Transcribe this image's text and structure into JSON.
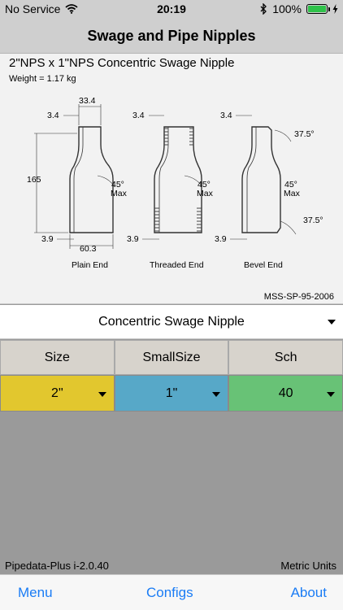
{
  "status_bar": {
    "carrier": "No Service",
    "time": "20:19",
    "battery": "100%"
  },
  "nav": {
    "title": "Swage and Pipe Nipples"
  },
  "product": {
    "title": "2\"NPS x 1\"NPS Concentric Swage Nipple",
    "weight_label": "Weight =",
    "weight_value": "1.17 kg",
    "standard": "MSS-SP-95-2006"
  },
  "drawing": {
    "dims": {
      "top_width": "33.4",
      "top_wall": "3.4",
      "height": "165",
      "bottom_wall": "3.9",
      "bottom_width": "60.3",
      "angle": "45°",
      "angle_qual": "Max",
      "bevel": "37.5°"
    },
    "captions": {
      "plain": "Plain End",
      "threaded": "Threaded End",
      "bevel": "Bevel End"
    }
  },
  "type_selector": {
    "value": "Concentric Swage Nipple"
  },
  "grid": {
    "headers": [
      "Size",
      "SmallSize",
      "Sch"
    ],
    "values": [
      "2\"",
      "1\"",
      "40"
    ],
    "colors": [
      "#e2c72e",
      "#57a8c8",
      "#68c276"
    ]
  },
  "footer": {
    "version": "Pipedata-Plus i-2.0.40",
    "units": "Metric Units"
  },
  "tabs": [
    "Menu",
    "Configs",
    "About"
  ],
  "accent_color": "#1a7cf5"
}
